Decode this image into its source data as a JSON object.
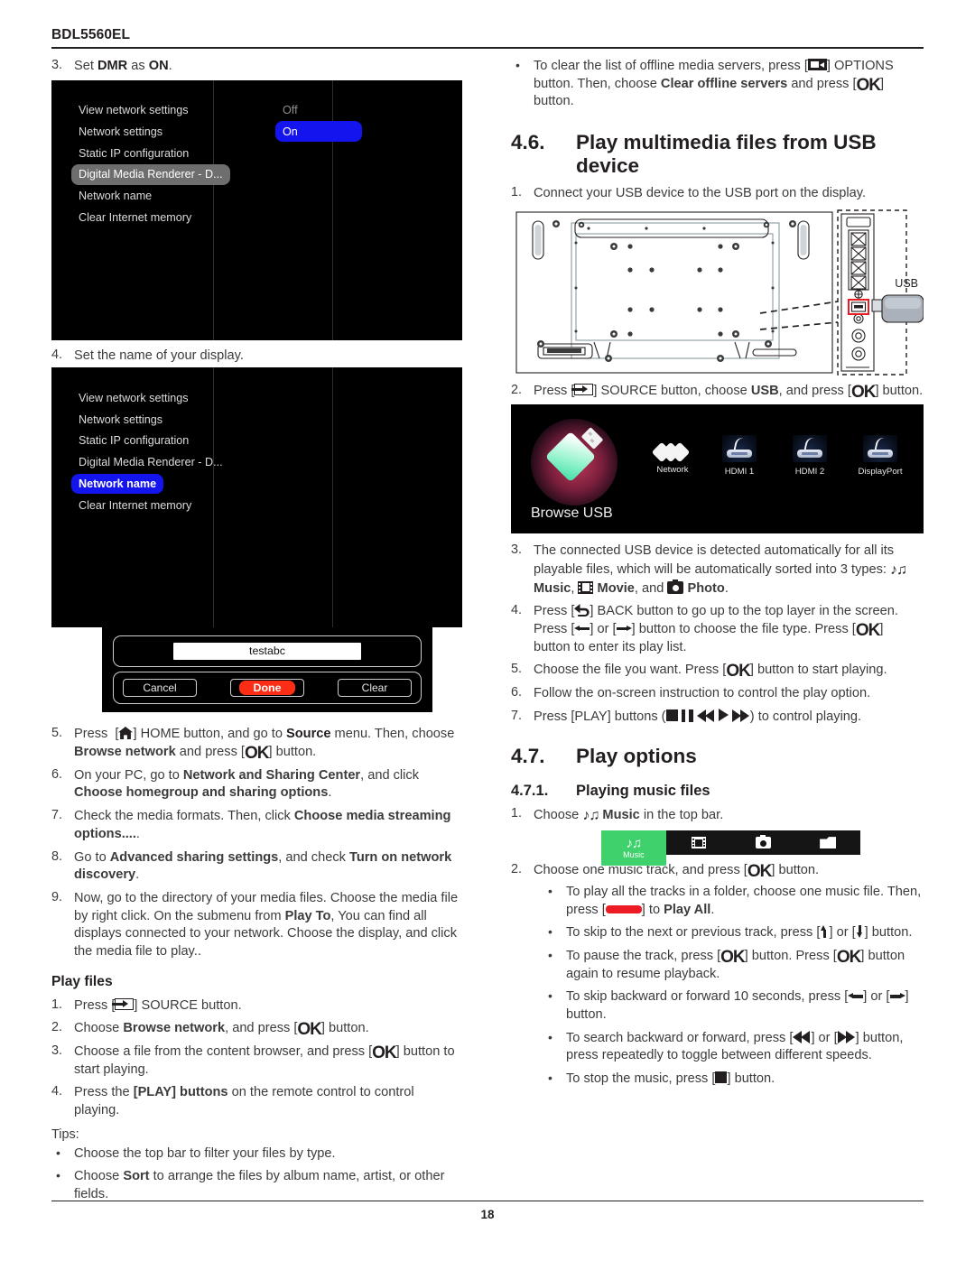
{
  "header": {
    "model": "BDL5560EL"
  },
  "footer": {
    "page_number": "18"
  },
  "left_column": {
    "step3": {
      "num": "3.",
      "pre": "Set ",
      "bold1": "DMR",
      "mid": " as ",
      "bold2": "ON",
      "post": "."
    },
    "osd_dmr": {
      "menu_items": [
        "View network settings",
        "Network settings",
        "Static IP configuration",
        "Digital Media Renderer - D...",
        "Network name",
        "Clear Internet memory"
      ],
      "selected_menu_index": 3,
      "values": [
        "Off",
        "On"
      ],
      "selected_value_index": 1
    },
    "step4": {
      "num": "4.",
      "text": "Set the name of your display."
    },
    "osd_name": {
      "menu_items": [
        "View network settings",
        "Network settings",
        "Static IP configuration",
        "Digital Media Renderer - D...",
        "Network name",
        "Clear Internet memory"
      ],
      "selected_menu_index": 4
    },
    "name_dialog": {
      "field_value": "testabc",
      "cancel_label": "Cancel",
      "done_label": "Done",
      "clear_label": "Clear",
      "done_color": "#ff2d16"
    },
    "steps": [
      {
        "num": "5.",
        "parts": [
          "Press [",
          "HOME_ICON",
          "] HOME button, and go to ",
          "B:Source",
          " menu. Then, choose ",
          "B:Browse network",
          " and press [",
          "OK",
          "] button."
        ]
      },
      {
        "num": "6.",
        "parts": [
          "On your PC, go to ",
          "B:Network and Sharing Center",
          ", and click ",
          "B:Choose homegroup and sharing options",
          "."
        ]
      },
      {
        "num": "7.",
        "parts": [
          "Check the media formats. Then, click ",
          "B:Choose media streaming options....",
          "."
        ]
      },
      {
        "num": "8.",
        "parts": [
          "Go to ",
          "B:Advanced sharing settings",
          ", and check ",
          "B:Turn on network discovery",
          "."
        ]
      },
      {
        "num": "9.",
        "parts": [
          "Now, go to the directory of your media files. Choose the media file by right click. On the submenu from ",
          "B:Play To",
          ", You can find all displays connected to your network. Choose the display, and click the media file to play.."
        ]
      }
    ],
    "play_files": {
      "heading": "Play files",
      "steps": [
        {
          "num": "1.",
          "parts": [
            "Press [",
            "SOURCE_ICON",
            "] SOURCE button."
          ]
        },
        {
          "num": "2.",
          "parts": [
            "Choose ",
            "B:Browse network",
            ", and press [",
            "OK",
            "] button."
          ]
        },
        {
          "num": "3.",
          "parts": [
            "Choose a file from the content browser, and press [",
            "OK",
            "] button to start playing."
          ]
        },
        {
          "num": "4.",
          "parts": [
            "Press the ",
            "B:[PLAY] buttons",
            " on the remote control to control playing."
          ]
        }
      ],
      "tips_label": "Tips:",
      "tips": [
        {
          "parts": [
            "Choose the top bar to filter your files by type."
          ]
        },
        {
          "parts": [
            "Choose ",
            "B:Sort",
            " to arrange the files by album name, artist, or other fields."
          ]
        }
      ]
    }
  },
  "right_column": {
    "offline_bullet": {
      "parts": [
        "To clear the list of offline media servers, press [",
        "OPTIONS_ICON",
        "] OPTIONS button. Then, choose ",
        "B:Clear offline servers",
        " and press [",
        "OK",
        "] button."
      ]
    },
    "section_46": {
      "number": "4.6.",
      "title_pre": "Play multimedia files from ",
      "title_bold": "USB device"
    },
    "step1": {
      "num": "1.",
      "text": "Connect your USB device to the USB port on the display."
    },
    "diagram": {
      "usb_label": "USB"
    },
    "step2": {
      "num": "2.",
      "parts": [
        "Press [",
        "SOURCE_ICON",
        "] SOURCE button, choose ",
        "B:USB",
        ", and press [",
        "OK",
        "] button."
      ]
    },
    "source_osd": {
      "browse_label": "Browse USB",
      "sources": [
        "Network",
        "HDMI 1",
        "HDMI 2",
        "DisplayPort"
      ]
    },
    "steps": [
      {
        "num": "3.",
        "parts": [
          "The connected USB device is detected automatically for all its playable files, which will be automatically sorted into 3 types: ",
          "MUSIC_ICON",
          "B:Music",
          ", ",
          "MOVIE_ICON",
          "B:Movie",
          ", and ",
          "PHOTO_ICON",
          "B:Photo",
          "."
        ]
      },
      {
        "num": "4.",
        "parts": [
          "Press [",
          "BACK_ICON",
          "] BACK button to go up to the top layer in the screen. Press [",
          "LEFT_ICON",
          "] or [",
          "RIGHT_ICON",
          "] button to choose the file type. Press [",
          "OK",
          "] button to enter its play list."
        ]
      },
      {
        "num": "5.",
        "parts": [
          "Choose the file you want. Press [",
          "OK",
          "] button to start playing."
        ]
      },
      {
        "num": "6.",
        "parts": [
          "Follow the on-screen instruction to control the play option."
        ]
      },
      {
        "num": "7.",
        "parts": [
          "Press [PLAY] buttons (",
          "STOP_ICON",
          "PAUSE_ICON",
          "REW_ICON",
          "PLAY_ICON",
          "FF_ICON",
          ") to control playing."
        ]
      }
    ],
    "section_47": {
      "number": "4.7.",
      "title": "Play options"
    },
    "section_471": {
      "number": "4.7.1.",
      "title": "Playing music files"
    },
    "music_step1": {
      "num": "1.",
      "parts": [
        "Choose ",
        "MUSIC_ICON",
        "B:Music",
        " in the top bar."
      ]
    },
    "topbar": {
      "active_label": "Music",
      "active_color": "#3fd16b",
      "tabs": [
        "Music",
        "Movie",
        "Photo",
        "Folder"
      ]
    },
    "music_step2": {
      "num": "2.",
      "parts": [
        "Choose one music track, and press [",
        "OK",
        "] button."
      ]
    },
    "music_bullets": [
      {
        "parts": [
          "To play all the tracks in a folder, choose one music file. Then, press [",
          "RED_KEY",
          "] to ",
          "B:Play All",
          "."
        ]
      },
      {
        "parts": [
          "To skip to the next or previous track, press [",
          "UP_ICON",
          "] or [",
          "DOWN_ICON",
          "] button."
        ]
      },
      {
        "parts": [
          "To pause the track, press [",
          "OK",
          "] button. Press [",
          "OK",
          "] button again to resume playback."
        ]
      },
      {
        "parts": [
          "To skip backward or forward 10 seconds, press [",
          "LEFT_ICON",
          "] or [",
          "RIGHT_ICON",
          "] button."
        ]
      },
      {
        "parts": [
          "To search backward or forward, press [",
          "REW_ICON",
          "] or [",
          "FF_ICON",
          "] button, press repeatedly to toggle between different speeds."
        ]
      },
      {
        "parts": [
          "To stop the music, press [",
          "STOP_ICON",
          "] button."
        ]
      }
    ]
  }
}
